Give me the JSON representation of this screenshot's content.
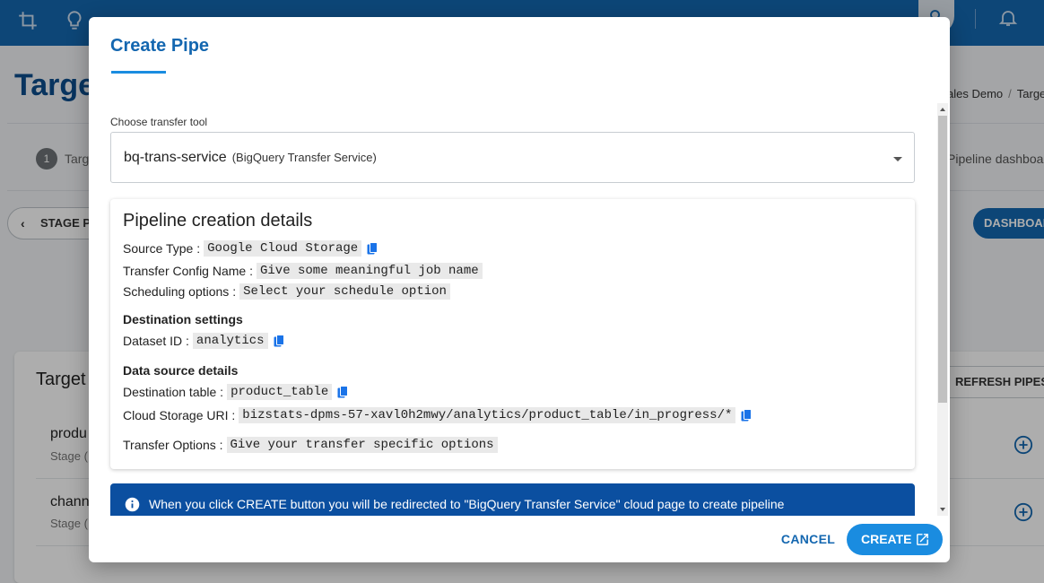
{
  "background": {
    "page_title": "Targe",
    "breadcrumb": {
      "item1": "ales Demo",
      "sep": "/",
      "item2": "Targe"
    },
    "stepper": {
      "step_number": "1",
      "step_label": "Targ",
      "right_label": "Pipeline dashboa"
    },
    "stage_button": "STAGE PI",
    "dashboard_button": "DASHBOAR",
    "card": {
      "title": "Target",
      "refresh_button": "REFRESH PIPES",
      "rows": [
        {
          "name": "produ",
          "sub": "Stage ("
        },
        {
          "name": "chann",
          "sub": "Stage ("
        }
      ]
    }
  },
  "modal": {
    "title": "Create Pipe",
    "transfer_tool": {
      "label": "Choose transfer tool",
      "value": "bq-trans-service",
      "value_sub": "(BigQuery Transfer Service)"
    },
    "details": {
      "title": "Pipeline creation details",
      "source_type_label": "Source Type :",
      "source_type_value": "Google Cloud Storage",
      "transfer_config_label": "Transfer Config Name :",
      "transfer_config_value": "Give some meaningful job name",
      "scheduling_label": "Scheduling options :",
      "scheduling_value": "Select your schedule option",
      "destination_heading": "Destination settings",
      "dataset_label": "Dataset ID :",
      "dataset_value": "analytics",
      "data_source_heading": "Data source details",
      "dest_table_label": "Destination table :",
      "dest_table_value": "product_table",
      "uri_label": "Cloud Storage URI :",
      "uri_value": "bizstats-dpms-57-xavl0h2mwy/analytics/product_table/in_progress/*",
      "transfer_options_label": "Transfer Options :",
      "transfer_options_value": "Give your transfer specific options"
    },
    "info_banner": "When you click CREATE button you will be redirected to \"BigQuery Transfer Service\" cloud page to create pipeline",
    "cancel_label": "CANCEL",
    "create_label": "CREATE"
  },
  "colors": {
    "primary": "#1467b0",
    "accent": "#1a8ce0",
    "banner": "#0b4fa0"
  }
}
